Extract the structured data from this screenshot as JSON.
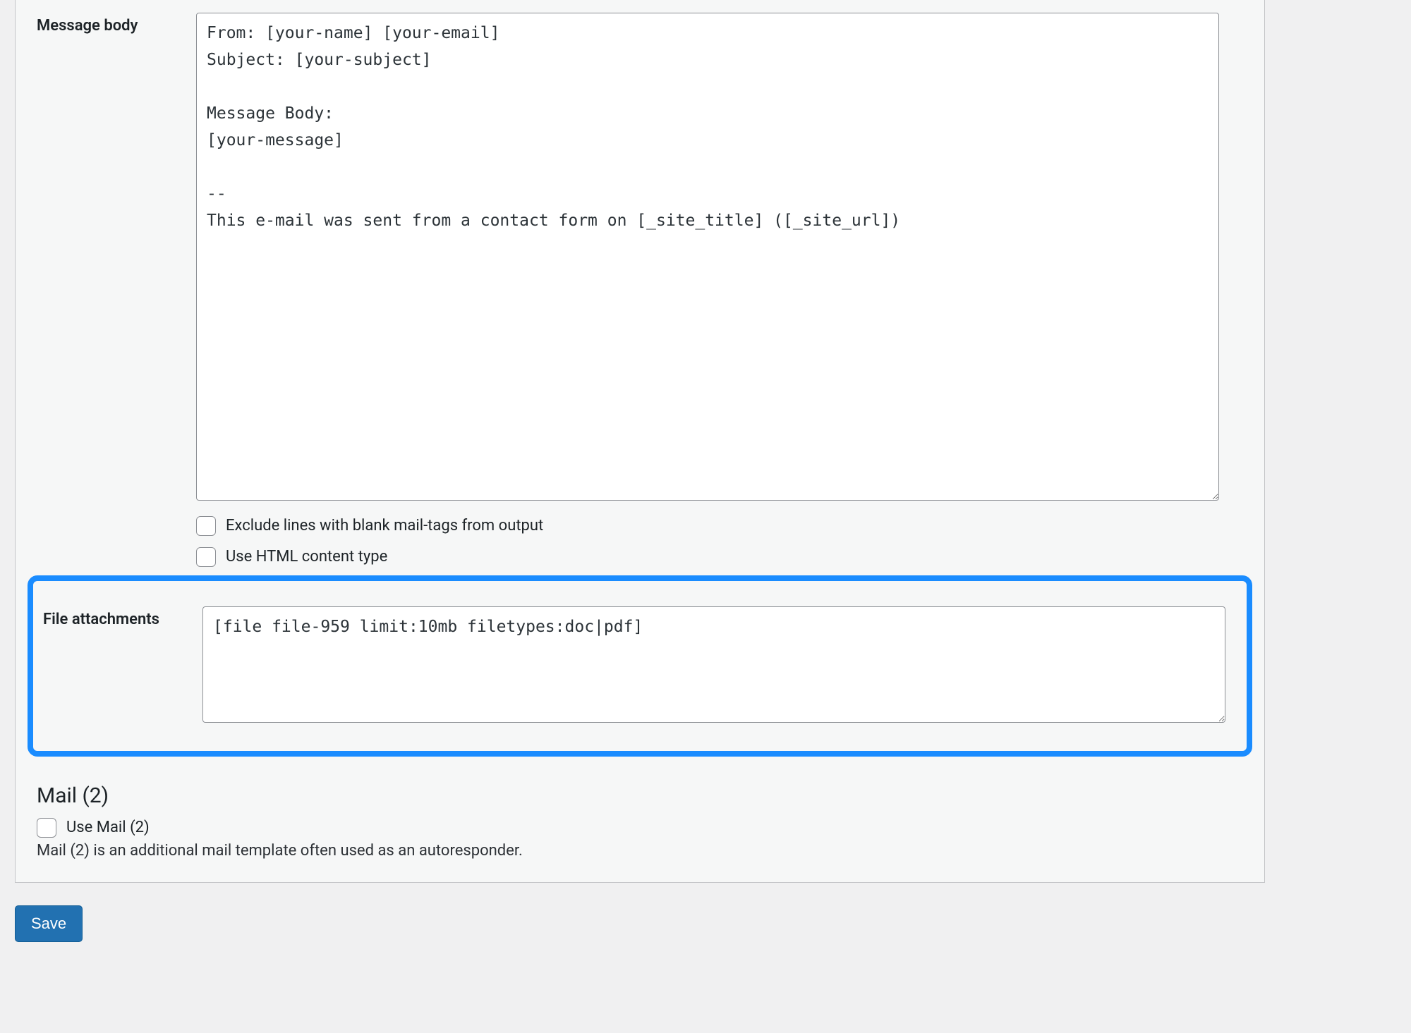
{
  "message_body": {
    "label": "Message body",
    "value": "From: [your-name] [your-email]\nSubject: [your-subject]\n\nMessage Body:\n[your-message]\n\n-- \nThis e-mail was sent from a contact form on [_site_title] ([_site_url])",
    "exclude_label": "Exclude lines with blank mail-tags from output",
    "html_label": "Use HTML content type"
  },
  "file_attachments": {
    "label": "File attachments",
    "value": "[file file-959 limit:10mb filetypes:doc|pdf]"
  },
  "mail2": {
    "title": "Mail (2)",
    "use_label": "Use Mail (2)",
    "desc": "Mail (2) is an additional mail template often used as an autoresponder."
  },
  "save_label": "Save"
}
